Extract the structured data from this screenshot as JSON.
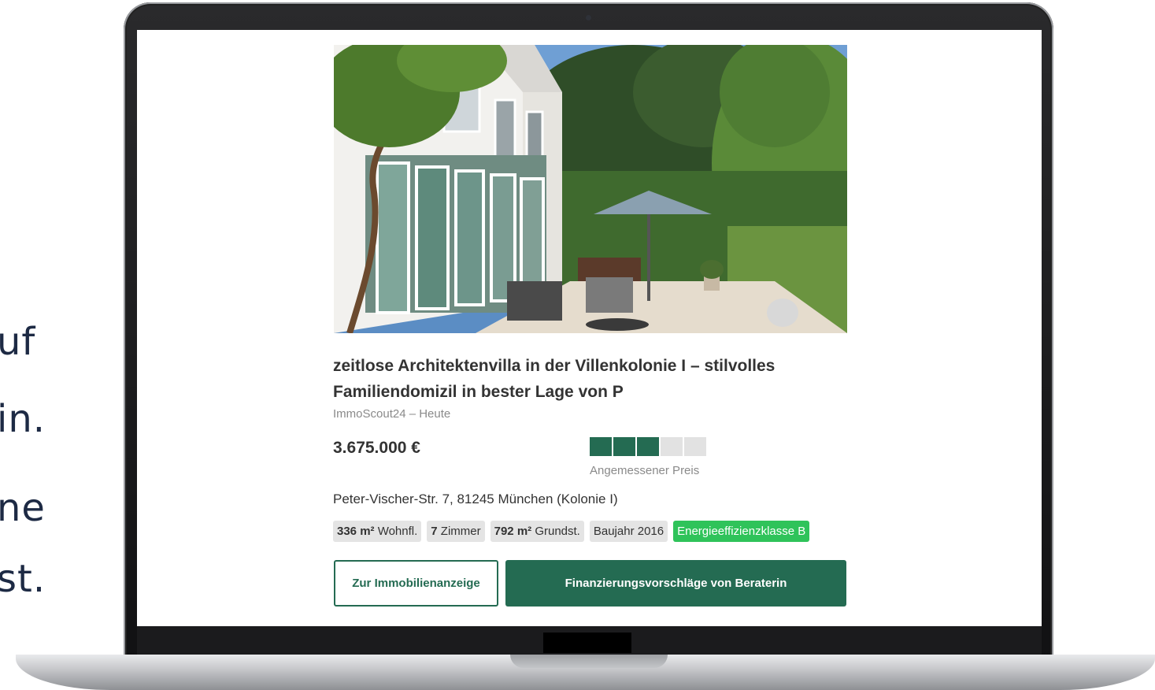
{
  "side_text": {
    "line1": "uf",
    "line2": "in.",
    "line3": "ne",
    "line4": "st."
  },
  "listing": {
    "title": "zeitlose Architektenvilla in der Villenkolonie I – stilvolles Familiendomizil in bester Lage von P",
    "source": "ImmoScout24 – Heute",
    "price": "3.675.000 €",
    "price_rating": {
      "filled": 3,
      "total": 5,
      "label": "Angemessener Preis",
      "color_filled": "#246b52",
      "color_empty": "#e2e2e2"
    },
    "address": "Peter-Vischer-Str. 7, 81245 München (Kolonie I)",
    "tags": [
      {
        "strong": "336 m²",
        "text": " Wohnfl."
      },
      {
        "strong": "7",
        "text": " Zimmer"
      },
      {
        "strong": "792 m²",
        "text": " Grundst."
      },
      {
        "strong": "",
        "text": "Baujahr 2016"
      }
    ],
    "energy_tag": "Energieeffizienzklasse B",
    "buttons": {
      "listing": "Zur Immobilienanzeige",
      "financing": "Finanzierungsvorschläge von Beraterin"
    },
    "accent_color": "#246b52"
  }
}
